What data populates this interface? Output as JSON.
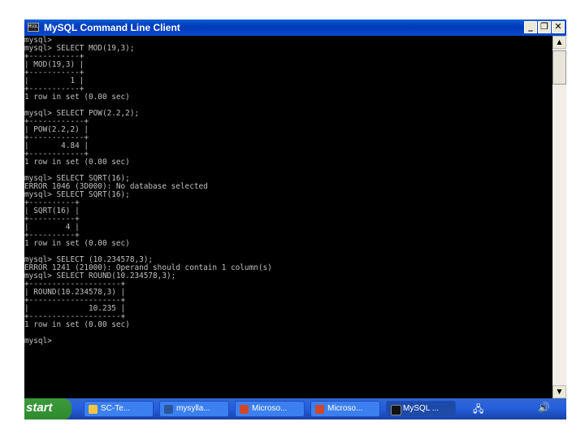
{
  "window": {
    "title": "MySQL Command Line Client",
    "icon_text": "MSQL",
    "controls": {
      "minimize": "_",
      "restore": "❐",
      "close": "✕"
    }
  },
  "console": {
    "lines": [
      "mysql>",
      "mysql> SELECT MOD(19,3);",
      "+-----------+",
      "| MOD(19,3) |",
      "+-----------+",
      "|         1 |",
      "+-----------+",
      "1 row in set (0.00 sec)",
      "",
      "mysql> SELECT POW(2.2,2);",
      "+------------+",
      "| POW(2.2,2) |",
      "+------------+",
      "|       4.84 |",
      "+------------+",
      "1 row in set (0.00 sec)",
      "",
      "mysql> SELECT SQRT(16);",
      "ERROR 1046 (3D000): No database selected",
      "mysql> SELECT SQRT(16);",
      "+----------+",
      "| SQRT(16) |",
      "+----------+",
      "|        4 |",
      "+----------+",
      "1 row in set (0.00 sec)",
      "",
      "mysql> SELECT (10.234578,3);",
      "ERROR 1241 (21000): Operand should contain 1 column(s)",
      "mysql> SELECT ROUND(10.234578,3);",
      "+--------------------+",
      "| ROUND(10.234578,3) |",
      "+--------------------+",
      "|             10.235 |",
      "+--------------------+",
      "1 row in set (0.00 sec)",
      "",
      "mysql>"
    ]
  },
  "scrollbar": {
    "up": "▲",
    "down": "▼"
  },
  "taskbar": {
    "start": "start",
    "tasks": [
      {
        "label": "SC-Te...",
        "icon": "folder-icon",
        "color": "#f4c542"
      },
      {
        "label": "mysylla...",
        "icon": "word-icon",
        "color": "#2b579a"
      },
      {
        "label": "Microso...",
        "icon": "powerpoint-icon",
        "color": "#d24726"
      },
      {
        "label": "Microso...",
        "icon": "powerpoint-icon",
        "color": "#d24726"
      },
      {
        "label": "MySQL ...",
        "icon": "console-icon",
        "color": "#111111"
      }
    ],
    "tray": {
      "network": "🖧",
      "speaker": "🔊"
    }
  }
}
